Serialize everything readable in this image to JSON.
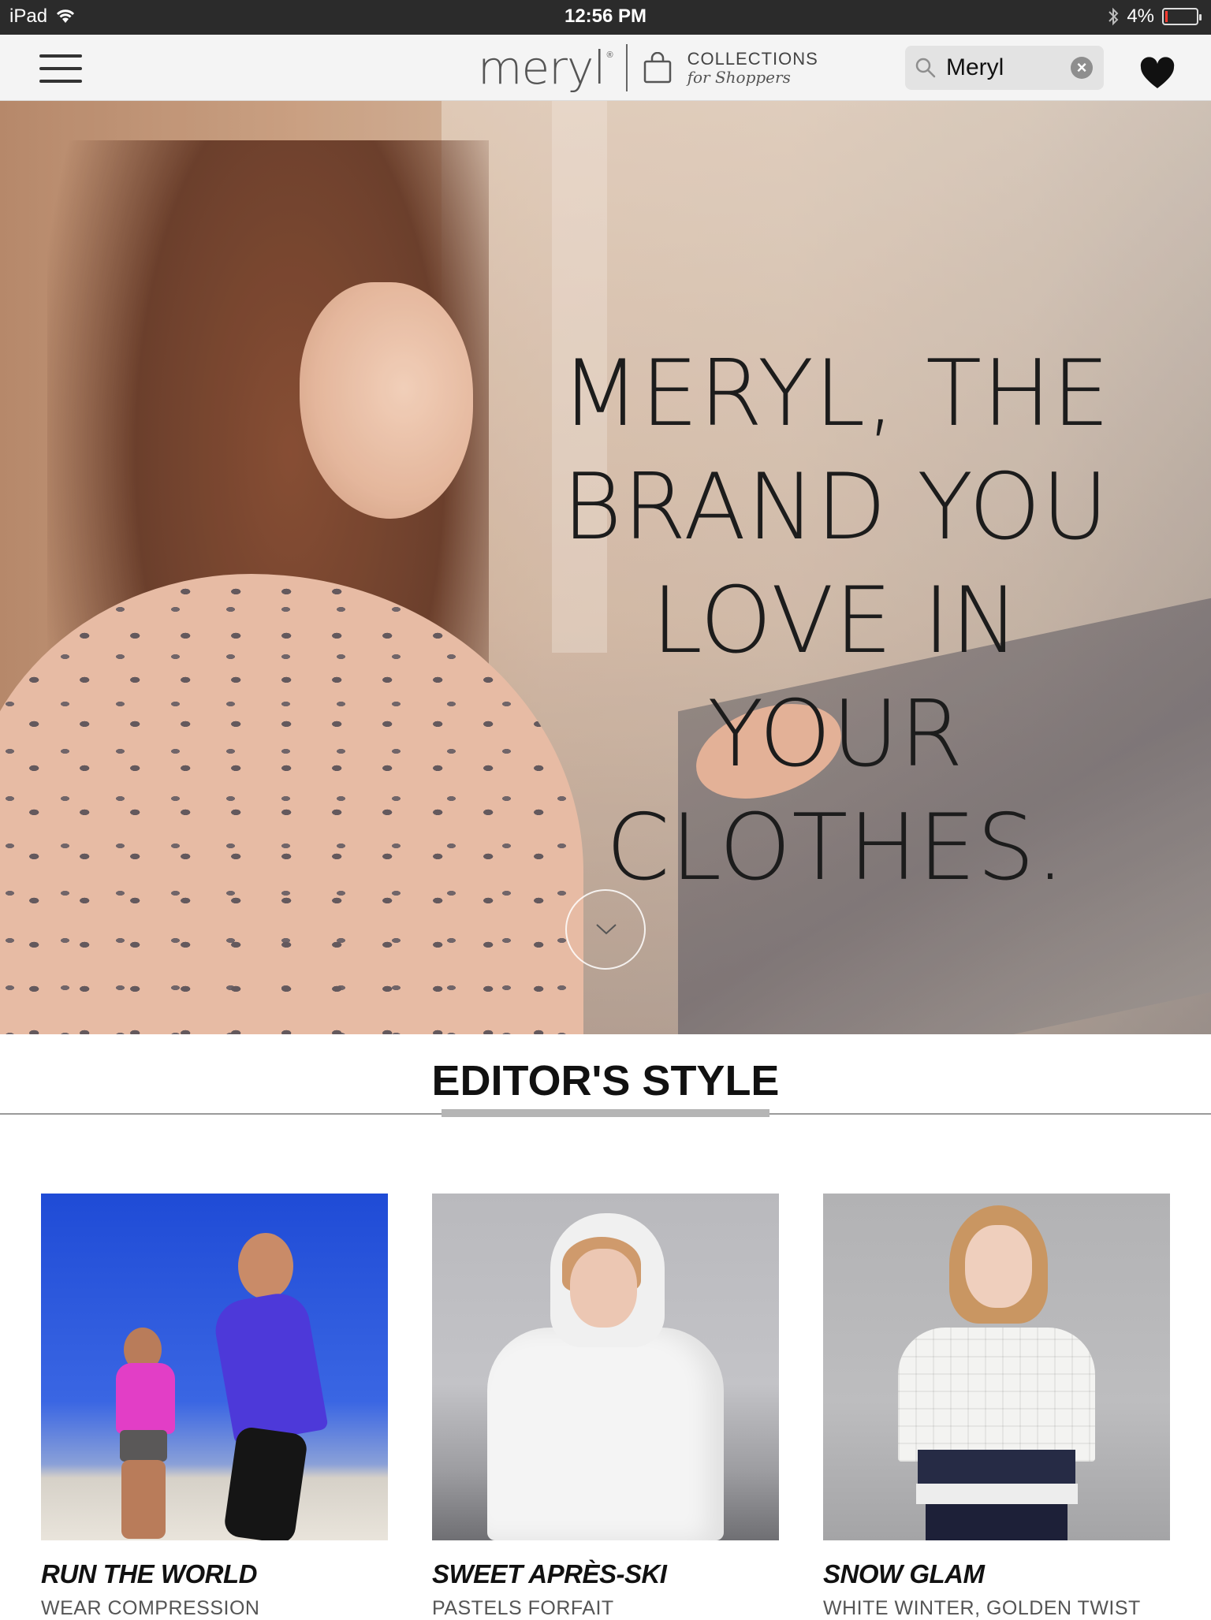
{
  "status_bar": {
    "device": "iPad",
    "time": "12:56 PM",
    "battery": "4%"
  },
  "nav": {
    "brand": "meryl",
    "collections_title": "COLLECTIONS",
    "collections_subtitle": "for Shoppers",
    "search": {
      "value": "Meryl",
      "clear": "×"
    }
  },
  "hero": {
    "headline": "MERYL, THE BRAND YOU LOVE IN YOUR CLOTHES."
  },
  "section": {
    "title": "EDITOR'S STYLE"
  },
  "cards": [
    {
      "title": "RUN THE WORLD",
      "subtitle": "WEAR COMPRESSION"
    },
    {
      "title": "SWEET APRÈS-SKI",
      "subtitle": "PASTELS FORFAIT"
    },
    {
      "title": "SNOW GLAM",
      "subtitle": "WHITE WINTER, GOLDEN TWIST"
    }
  ],
  "colors": {
    "status_bar_bg": "#2b2b2b",
    "nav_bg": "#f4f4f4",
    "search_bg": "#e3e3e3",
    "battery_low": "#ff3b30"
  },
  "icons": [
    "wifi-icon",
    "bluetooth-icon",
    "battery-icon",
    "hamburger-menu-icon",
    "shopping-bag-icon",
    "search-icon",
    "clear-icon",
    "heart-icon",
    "chevron-down-icon"
  ]
}
